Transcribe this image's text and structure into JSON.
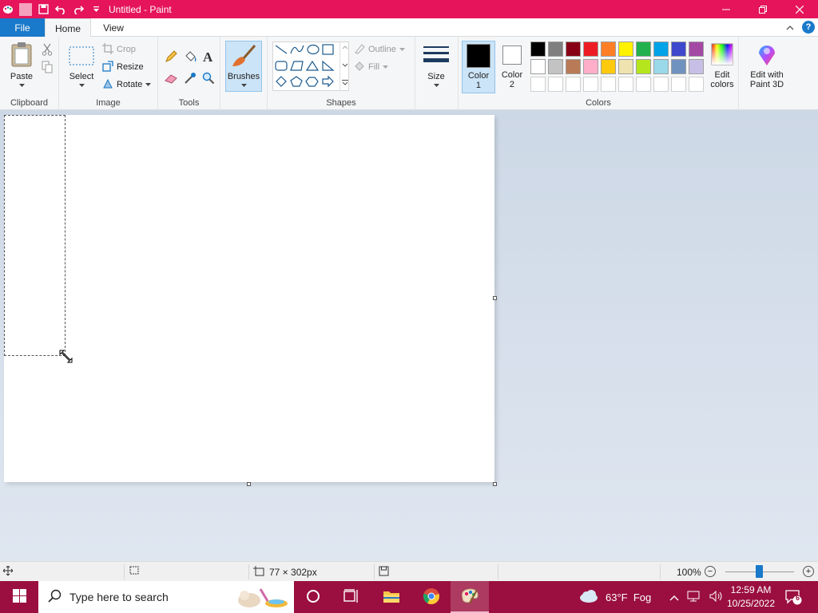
{
  "window": {
    "title": "Untitled - Paint",
    "controls": {
      "minimize": "minimize-icon",
      "restore": "restore-icon",
      "close": "close-icon"
    }
  },
  "tabs": [
    {
      "label": "File"
    },
    {
      "label": "Home"
    },
    {
      "label": "View"
    }
  ],
  "ribbon": {
    "clipboard": {
      "label": "Clipboard",
      "paste": "Paste"
    },
    "image": {
      "label": "Image",
      "select": "Select",
      "crop": "Crop",
      "resize": "Resize",
      "rotate": "Rotate"
    },
    "tools": {
      "label": "Tools"
    },
    "brushes": {
      "label": "Brushes"
    },
    "shapes": {
      "label": "Shapes",
      "outline": "Outline",
      "fill": "Fill"
    },
    "size": {
      "label": "Size"
    },
    "colors": {
      "label": "Colors",
      "color1": "Color 1",
      "color1_line1": "Color",
      "color1_line2": "1",
      "color2_line1": "Color",
      "color2_line2": "2",
      "edit_colors_line1": "Edit",
      "edit_colors_line2": "colors",
      "paint3d_line1": "Edit with",
      "paint3d_line2": "Paint 3D",
      "color1_value": "#000000",
      "color2_value": "#ffffff",
      "palette_row1": [
        "#000000",
        "#7f7f7f",
        "#880015",
        "#ed1c24",
        "#ff7f27",
        "#fff200",
        "#22b14c",
        "#00a2e8",
        "#3f48cc",
        "#a349a4"
      ],
      "palette_row2": [
        "#ffffff",
        "#c3c3c3",
        "#b97a57",
        "#ffaec9",
        "#ffc90e",
        "#efe4b0",
        "#b5e61d",
        "#99d9ea",
        "#7092be",
        "#c8bfe7"
      ]
    }
  },
  "statusbar": {
    "selection_size": "77 × 302px",
    "zoom": "100%"
  },
  "taskbar": {
    "search_placeholder": "Type here to search",
    "weather": "63°F  Fog",
    "time": "12:59 AM",
    "date": "10/25/2022",
    "notifications": "6"
  }
}
